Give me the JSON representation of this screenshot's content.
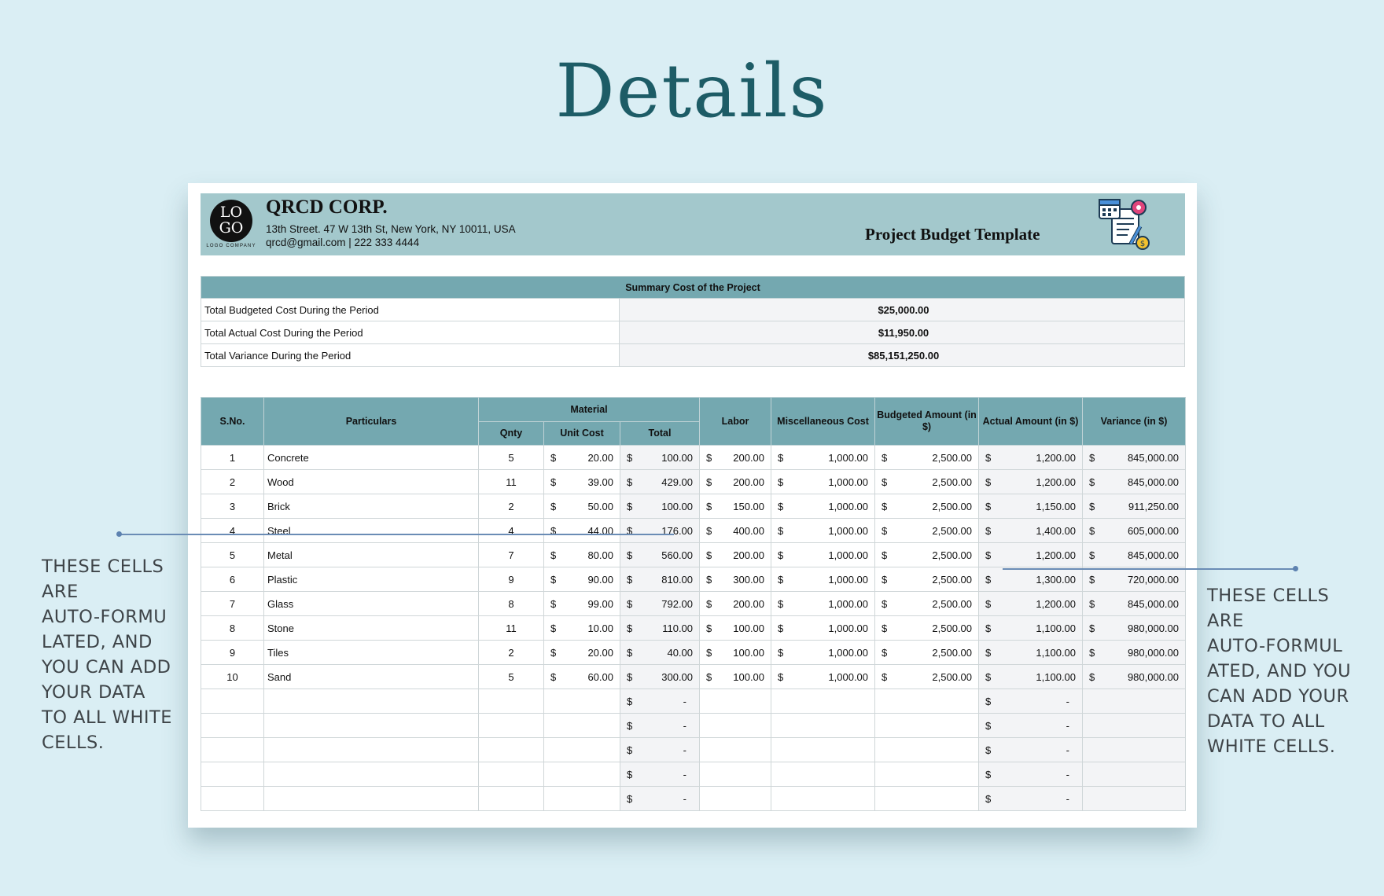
{
  "page_title": "Details",
  "header": {
    "logo_text_top": "LO",
    "logo_text_bottom": "GO",
    "logo_caption": "LOGO COMPANY",
    "company": "QRCD CORP.",
    "address": "13th Street. 47 W 13th St, New York, NY 10011, USA",
    "contact": "qrcd@gmail.com | 222 333 4444",
    "template_title": "Project Budget Template"
  },
  "summary": {
    "title": "Summary Cost of the Project",
    "rows": [
      {
        "label": "Total Budgeted Cost During the Period",
        "value": "$25,000.00"
      },
      {
        "label": "Total Actual Cost During the Period",
        "value": "$11,950.00"
      },
      {
        "label": "Total Variance During the Period",
        "value": "$85,151,250.00"
      }
    ]
  },
  "table": {
    "headers": {
      "sno": "S.No.",
      "particulars": "Particulars",
      "material": "Material",
      "qnty": "Qnty",
      "unit_cost": "Unit Cost",
      "total": "Total",
      "labor": "Labor",
      "misc": "Miscellaneous Cost",
      "budgeted": "Budgeted Amount (in $)",
      "actual": "Actual Amount (in $)",
      "variance": "Variance (in $)"
    },
    "currency": "$",
    "dash": "-",
    "rows": [
      {
        "sno": "1",
        "particular": "Concrete",
        "qnty": "5",
        "unit_cost": "20.00",
        "total": "100.00",
        "labor": "200.00",
        "misc": "1,000.00",
        "budgeted": "2,500.00",
        "actual": "1,200.00",
        "variance": "845,000.00"
      },
      {
        "sno": "2",
        "particular": "Wood",
        "qnty": "11",
        "unit_cost": "39.00",
        "total": "429.00",
        "labor": "200.00",
        "misc": "1,000.00",
        "budgeted": "2,500.00",
        "actual": "1,200.00",
        "variance": "845,000.00"
      },
      {
        "sno": "3",
        "particular": "Brick",
        "qnty": "2",
        "unit_cost": "50.00",
        "total": "100.00",
        "labor": "150.00",
        "misc": "1,000.00",
        "budgeted": "2,500.00",
        "actual": "1,150.00",
        "variance": "911,250.00"
      },
      {
        "sno": "4",
        "particular": "Steel",
        "qnty": "4",
        "unit_cost": "44.00",
        "total": "176.00",
        "labor": "400.00",
        "misc": "1,000.00",
        "budgeted": "2,500.00",
        "actual": "1,400.00",
        "variance": "605,000.00"
      },
      {
        "sno": "5",
        "particular": "Metal",
        "qnty": "7",
        "unit_cost": "80.00",
        "total": "560.00",
        "labor": "200.00",
        "misc": "1,000.00",
        "budgeted": "2,500.00",
        "actual": "1,200.00",
        "variance": "845,000.00"
      },
      {
        "sno": "6",
        "particular": "Plastic",
        "qnty": "9",
        "unit_cost": "90.00",
        "total": "810.00",
        "labor": "300.00",
        "misc": "1,000.00",
        "budgeted": "2,500.00",
        "actual": "1,300.00",
        "variance": "720,000.00"
      },
      {
        "sno": "7",
        "particular": "Glass",
        "qnty": "8",
        "unit_cost": "99.00",
        "total": "792.00",
        "labor": "200.00",
        "misc": "1,000.00",
        "budgeted": "2,500.00",
        "actual": "1,200.00",
        "variance": "845,000.00"
      },
      {
        "sno": "8",
        "particular": "Stone",
        "qnty": "11",
        "unit_cost": "10.00",
        "total": "110.00",
        "labor": "100.00",
        "misc": "1,000.00",
        "budgeted": "2,500.00",
        "actual": "1,100.00",
        "variance": "980,000.00"
      },
      {
        "sno": "9",
        "particular": "Tiles",
        "qnty": "2",
        "unit_cost": "20.00",
        "total": "40.00",
        "labor": "100.00",
        "misc": "1,000.00",
        "budgeted": "2,500.00",
        "actual": "1,100.00",
        "variance": "980,000.00"
      },
      {
        "sno": "10",
        "particular": "Sand",
        "qnty": "5",
        "unit_cost": "60.00",
        "total": "300.00",
        "labor": "100.00",
        "misc": "1,000.00",
        "budgeted": "2,500.00",
        "actual": "1,100.00",
        "variance": "980,000.00"
      }
    ],
    "empty_rows": 5
  },
  "notes": {
    "left": [
      "THESE CELLS",
      "ARE",
      "AUTO-FORMU",
      "LATED, AND",
      "YOU CAN ADD",
      "YOUR DATA",
      "TO ALL WHITE",
      "CELLS."
    ],
    "right": [
      "THESE CELLS",
      "ARE",
      "AUTO-FORMUL",
      "ATED, AND YOU",
      "CAN ADD YOUR",
      "DATA TO ALL",
      "WHITE CELLS."
    ]
  },
  "colors": {
    "background": "#daeef4",
    "title": "#1d5c66",
    "header_band": "#a3c8cc",
    "table_header": "#74a8b0",
    "formula_cell": "#f3f4f6"
  }
}
